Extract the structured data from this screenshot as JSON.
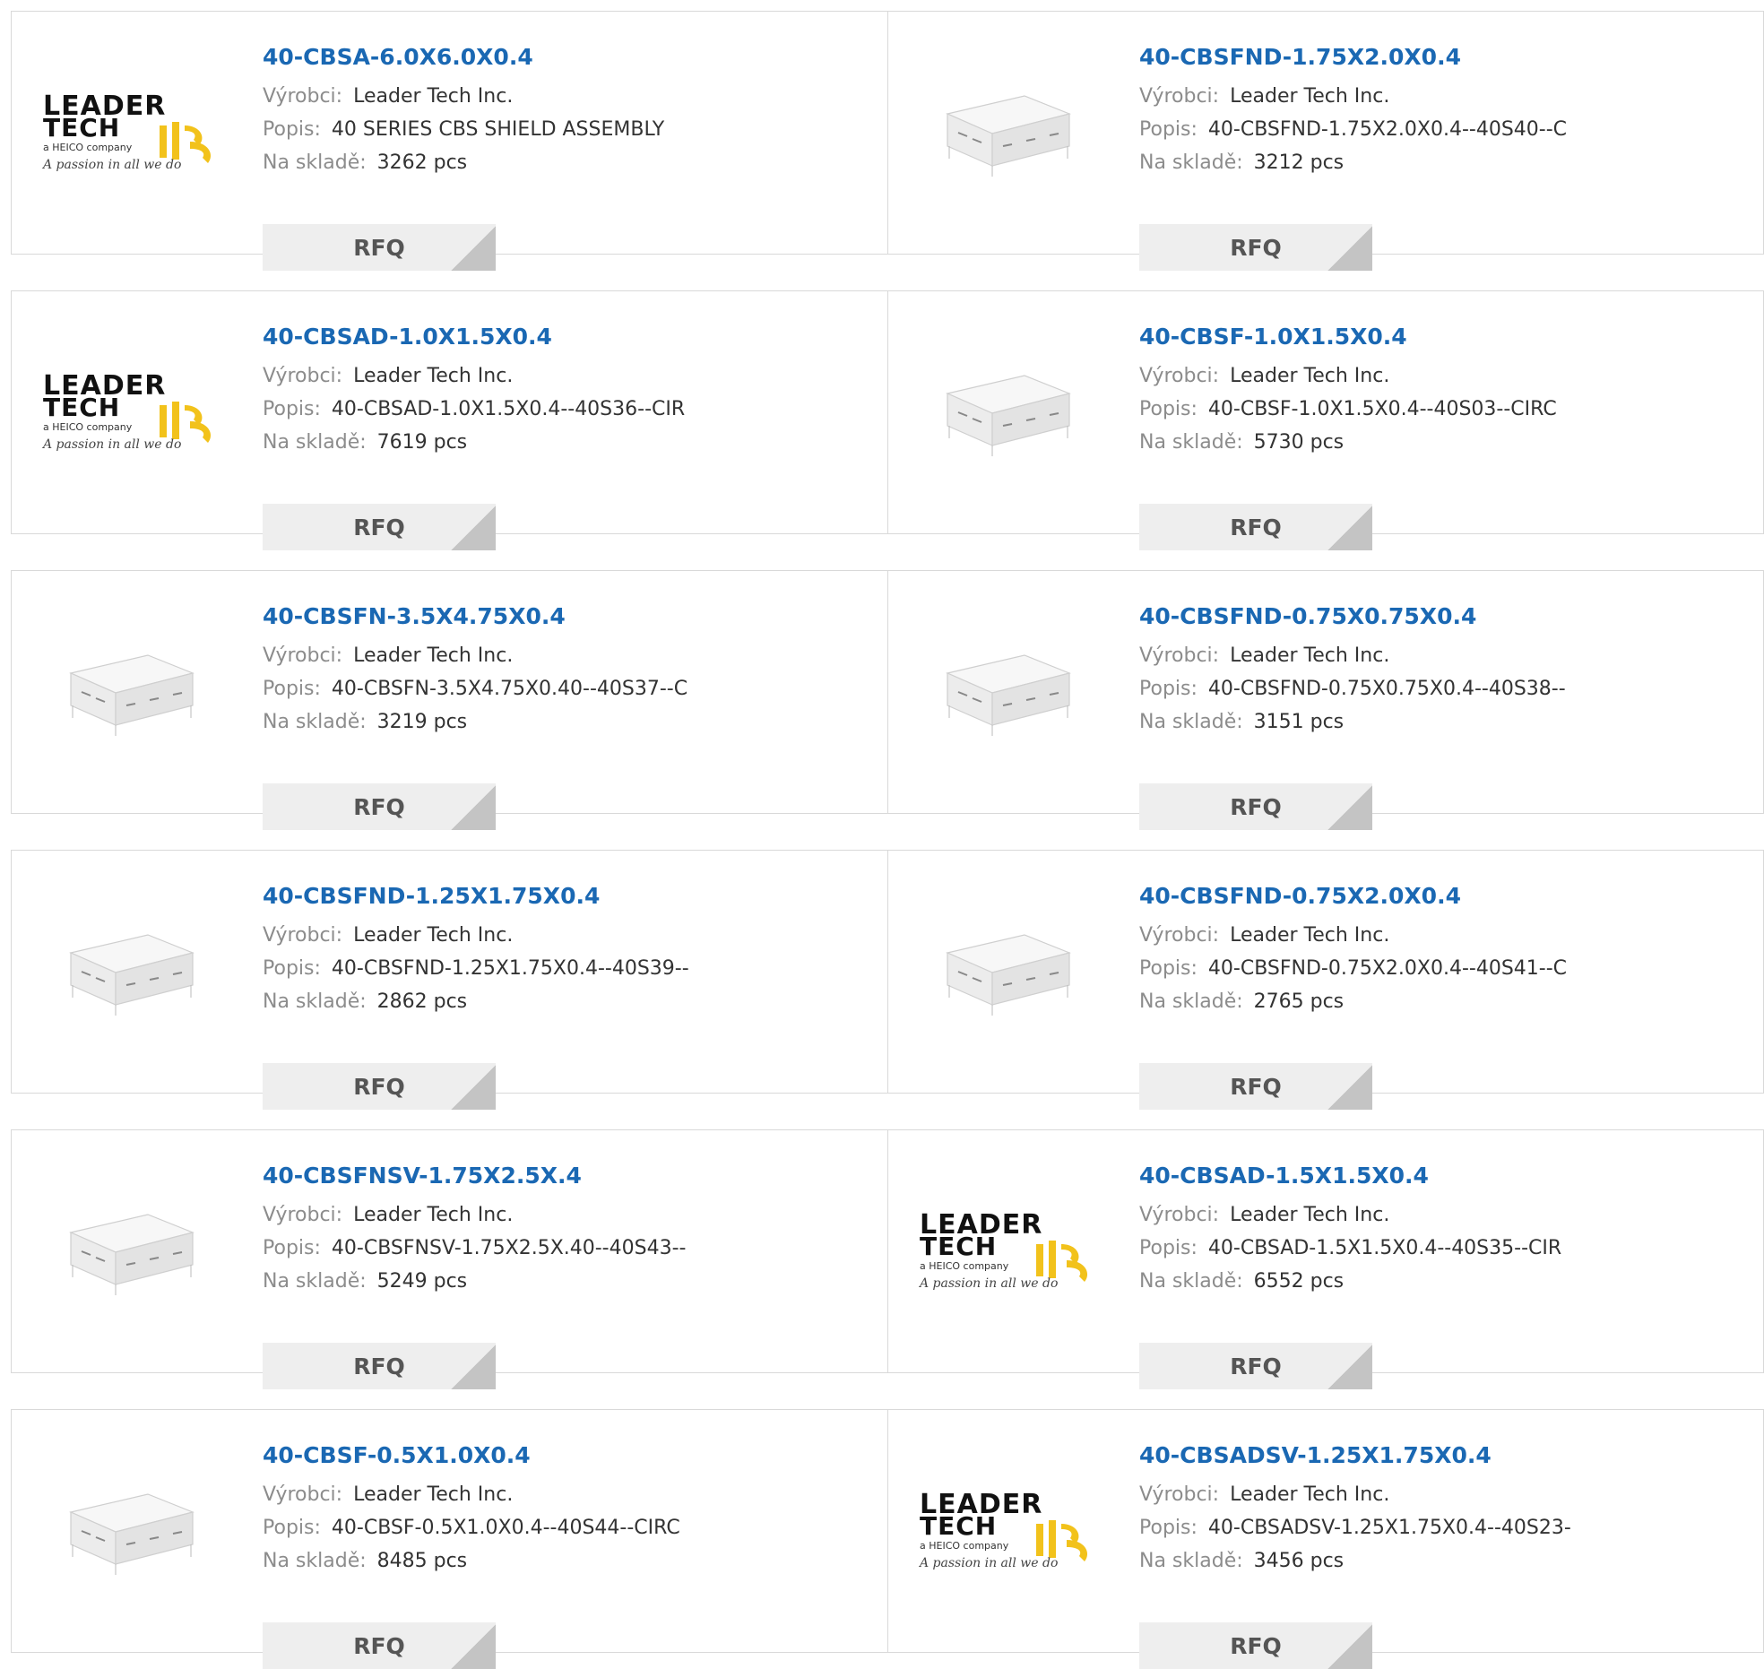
{
  "brand": {
    "line1": "LEADER",
    "line2": "TECH",
    "tagline": "a HEICO company",
    "slogan": "A passion in all we do"
  },
  "labels": {
    "manufacturer": "Výrobci:",
    "description": "Popis:",
    "stock": "Na skladě:",
    "rfq": "RFQ"
  },
  "products": [
    {
      "part": "40-CBSA-6.0X6.0X0.4",
      "manufacturer": "Leader Tech Inc.",
      "description": "40 SERIES CBS SHIELD ASSEMBLY",
      "stock": "3262 pcs",
      "image": "logo"
    },
    {
      "part": "40-CBSFND-1.75X2.0X0.4",
      "manufacturer": "Leader Tech Inc.",
      "description": "40-CBSFND-1.75X2.0X0.4--40S40--C",
      "stock": "3212 pcs",
      "image": "shield"
    },
    {
      "part": "40-CBSAD-1.0X1.5X0.4",
      "manufacturer": "Leader Tech Inc.",
      "description": "40-CBSAD-1.0X1.5X0.4--40S36--CIR",
      "stock": "7619 pcs",
      "image": "logo"
    },
    {
      "part": "40-CBSF-1.0X1.5X0.4",
      "manufacturer": "Leader Tech Inc.",
      "description": "40-CBSF-1.0X1.5X0.4--40S03--CIRC",
      "stock": "5730 pcs",
      "image": "shield"
    },
    {
      "part": "40-CBSFN-3.5X4.75X0.4",
      "manufacturer": "Leader Tech Inc.",
      "description": "40-CBSFN-3.5X4.75X0.40--40S37--C",
      "stock": "3219 pcs",
      "image": "shield"
    },
    {
      "part": "40-CBSFND-0.75X0.75X0.4",
      "manufacturer": "Leader Tech Inc.",
      "description": "40-CBSFND-0.75X0.75X0.4--40S38--",
      "stock": "3151 pcs",
      "image": "shield"
    },
    {
      "part": "40-CBSFND-1.25X1.75X0.4",
      "manufacturer": "Leader Tech Inc.",
      "description": "40-CBSFND-1.25X1.75X0.4--40S39--",
      "stock": "2862 pcs",
      "image": "shield"
    },
    {
      "part": "40-CBSFND-0.75X2.0X0.4",
      "manufacturer": "Leader Tech Inc.",
      "description": "40-CBSFND-0.75X2.0X0.4--40S41--C",
      "stock": "2765 pcs",
      "image": "shield"
    },
    {
      "part": "40-CBSFNSV-1.75X2.5X.4",
      "manufacturer": "Leader Tech Inc.",
      "description": "40-CBSFNSV-1.75X2.5X.40--40S43--",
      "stock": "5249 pcs",
      "image": "shield"
    },
    {
      "part": "40-CBSAD-1.5X1.5X0.4",
      "manufacturer": "Leader Tech Inc.",
      "description": "40-CBSAD-1.5X1.5X0.4--40S35--CIR",
      "stock": "6552 pcs",
      "image": "logo"
    },
    {
      "part": "40-CBSF-0.5X1.0X0.4",
      "manufacturer": "Leader Tech Inc.",
      "description": "40-CBSF-0.5X1.0X0.4--40S44--CIRC",
      "stock": "8485 pcs",
      "image": "shield"
    },
    {
      "part": "40-CBSADSV-1.25X1.75X0.4",
      "manufacturer": "Leader Tech Inc.",
      "description": "40-CBSADSV-1.25X1.75X0.4--40S23-",
      "stock": "3456 pcs",
      "image": "logo"
    }
  ],
  "colors": {
    "link": "#1a68b3",
    "label": "#8c8c8c",
    "border": "#d9d9d9",
    "button": "#eeeeee",
    "logo_yellow": "#f2c21b"
  }
}
